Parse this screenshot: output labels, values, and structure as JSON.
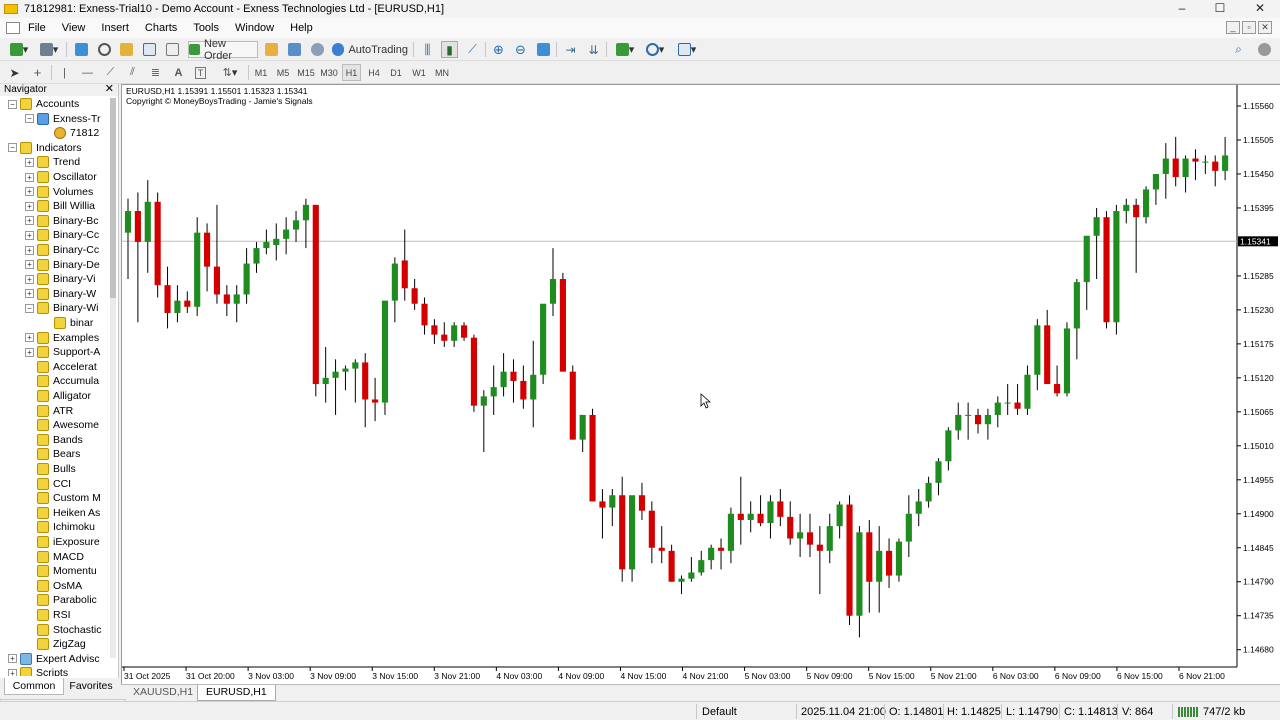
{
  "window": {
    "title": "71812981: Exness-Trial10 - Demo Account - Exness Technologies Ltd - [EURUSD,H1]",
    "controls": [
      "–",
      "☐",
      "✕"
    ]
  },
  "menu": [
    "File",
    "View",
    "Insert",
    "Charts",
    "Tools",
    "Window",
    "Help"
  ],
  "toolbar1": {
    "new_order_label": "New Order",
    "autotrading_label": "AutoTrading"
  },
  "timeframes": [
    "M1",
    "M5",
    "M15",
    "M30",
    "H1",
    "H4",
    "D1",
    "W1",
    "MN"
  ],
  "active_timeframe": "H1",
  "navigator": {
    "title": "Navigator",
    "close": "✕",
    "items": [
      {
        "label": "Accounts",
        "indent": 0,
        "expand": "−",
        "icon": "folder"
      },
      {
        "label": "Exness-Tr",
        "indent": 1,
        "expand": "−",
        "icon": "account"
      },
      {
        "label": "71812",
        "indent": 2,
        "expand": "",
        "icon": "user"
      },
      {
        "label": "Indicators",
        "indent": 0,
        "expand": "−",
        "icon": "folder"
      },
      {
        "label": "Trend",
        "indent": 1,
        "expand": "+",
        "icon": "folder"
      },
      {
        "label": "Oscillator",
        "indent": 1,
        "expand": "+",
        "icon": "folder"
      },
      {
        "label": "Volumes",
        "indent": 1,
        "expand": "+",
        "icon": "folder"
      },
      {
        "label": "Bill Willia",
        "indent": 1,
        "expand": "+",
        "icon": "folder"
      },
      {
        "label": "Binary-Bc",
        "indent": 1,
        "expand": "+",
        "icon": "folder"
      },
      {
        "label": "Binary-Cc",
        "indent": 1,
        "expand": "+",
        "icon": "folder"
      },
      {
        "label": "Binary-Cc",
        "indent": 1,
        "expand": "+",
        "icon": "folder"
      },
      {
        "label": "Binary-De",
        "indent": 1,
        "expand": "+",
        "icon": "folder"
      },
      {
        "label": "Binary-Vi",
        "indent": 1,
        "expand": "+",
        "icon": "folder"
      },
      {
        "label": "Binary-W",
        "indent": 1,
        "expand": "+",
        "icon": "folder"
      },
      {
        "label": "Binary-Wi",
        "indent": 1,
        "expand": "−",
        "icon": "folder"
      },
      {
        "label": "binar",
        "indent": 2,
        "expand": "",
        "icon": "indicator"
      },
      {
        "label": "Examples",
        "indent": 1,
        "expand": "+",
        "icon": "folder"
      },
      {
        "label": "Support-A",
        "indent": 1,
        "expand": "+",
        "icon": "folder"
      },
      {
        "label": "Accelerat",
        "indent": 1,
        "expand": "",
        "icon": "indicator"
      },
      {
        "label": "Accumula",
        "indent": 1,
        "expand": "",
        "icon": "indicator"
      },
      {
        "label": "Alligator",
        "indent": 1,
        "expand": "",
        "icon": "indicator"
      },
      {
        "label": "ATR",
        "indent": 1,
        "expand": "",
        "icon": "indicator"
      },
      {
        "label": "Awesome",
        "indent": 1,
        "expand": "",
        "icon": "indicator"
      },
      {
        "label": "Bands",
        "indent": 1,
        "expand": "",
        "icon": "indicator"
      },
      {
        "label": "Bears",
        "indent": 1,
        "expand": "",
        "icon": "indicator"
      },
      {
        "label": "Bulls",
        "indent": 1,
        "expand": "",
        "icon": "indicator"
      },
      {
        "label": "CCI",
        "indent": 1,
        "expand": "",
        "icon": "indicator"
      },
      {
        "label": "Custom M",
        "indent": 1,
        "expand": "",
        "icon": "indicator"
      },
      {
        "label": "Heiken As",
        "indent": 1,
        "expand": "",
        "icon": "indicator"
      },
      {
        "label": "Ichimoku",
        "indent": 1,
        "expand": "",
        "icon": "indicator"
      },
      {
        "label": "iExposure",
        "indent": 1,
        "expand": "",
        "icon": "indicator"
      },
      {
        "label": "MACD",
        "indent": 1,
        "expand": "",
        "icon": "indicator"
      },
      {
        "label": "Momentu",
        "indent": 1,
        "expand": "",
        "icon": "indicator"
      },
      {
        "label": "OsMA",
        "indent": 1,
        "expand": "",
        "icon": "indicator"
      },
      {
        "label": "Parabolic",
        "indent": 1,
        "expand": "",
        "icon": "indicator"
      },
      {
        "label": "RSI",
        "indent": 1,
        "expand": "",
        "icon": "indicator"
      },
      {
        "label": "Stochastic",
        "indent": 1,
        "expand": "",
        "icon": "indicator"
      },
      {
        "label": "ZigZag",
        "indent": 1,
        "expand": "",
        "icon": "indicator"
      },
      {
        "label": "Expert Advisc",
        "indent": 0,
        "expand": "+",
        "icon": "ea"
      },
      {
        "label": "Scripts",
        "indent": 0,
        "expand": "+",
        "icon": "folder"
      }
    ],
    "tabs": [
      "Common",
      "Favorites"
    ],
    "active_tab": "Common"
  },
  "chart": {
    "header": "EURUSD,H1  1.15391 1.15501 1.15323 1.15341",
    "copyright": "Copyright © MoneyBoysTrading - Jamie's Signals",
    "current_price_label": "1.15341"
  },
  "chart_data": {
    "type": "candlestick",
    "symbol": "EURUSD",
    "timeframe": "H1",
    "ylim": [
      1.14652,
      1.15594
    ],
    "y_ticks": [
      "1.15560",
      "1.15505",
      "1.15450",
      "1.15395",
      "1.15285",
      "1.15230",
      "1.15175",
      "1.15120",
      "1.15065",
      "1.15010",
      "1.14955",
      "1.14900",
      "1.14845",
      "1.14790",
      "1.14735",
      "1.14680"
    ],
    "x_labels": [
      "31 Oct 2025",
      "31 Oct 20:00",
      "3 Nov 03:00",
      "3 Nov 09:00",
      "3 Nov 15:00",
      "3 Nov 21:00",
      "4 Nov 03:00",
      "4 Nov 09:00",
      "4 Nov 15:00",
      "4 Nov 21:00",
      "5 Nov 03:00",
      "5 Nov 09:00",
      "5 Nov 15:00",
      "5 Nov 21:00",
      "6 Nov 03:00",
      "6 Nov 09:00",
      "6 Nov 15:00",
      "6 Nov 21:00"
    ],
    "current_price": 1.15341,
    "up_color": "#1e8c1e",
    "down_color": "#d40000",
    "candles": [
      [
        1.15355,
        1.1541,
        1.1528,
        1.1539
      ],
      [
        1.1539,
        1.1542,
        1.1521,
        1.1534
      ],
      [
        1.1534,
        1.1544,
        1.1529,
        1.15405
      ],
      [
        1.15405,
        1.1542,
        1.1525,
        1.1527
      ],
      [
        1.1527,
        1.153,
        1.152,
        1.15225
      ],
      [
        1.15225,
        1.1527,
        1.1521,
        1.15245
      ],
      [
        1.15245,
        1.1526,
        1.15225,
        1.15235
      ],
      [
        1.15235,
        1.1538,
        1.1522,
        1.15355
      ],
      [
        1.15355,
        1.1537,
        1.1526,
        1.153
      ],
      [
        1.153,
        1.154,
        1.1524,
        1.15255
      ],
      [
        1.15255,
        1.1527,
        1.1522,
        1.1524
      ],
      [
        1.1524,
        1.1527,
        1.1521,
        1.15255
      ],
      [
        1.15255,
        1.1533,
        1.1524,
        1.15305
      ],
      [
        1.15305,
        1.1534,
        1.1529,
        1.1533
      ],
      [
        1.1533,
        1.1536,
        1.1532,
        1.1534
      ],
      [
        1.15335,
        1.1537,
        1.1531,
        1.15345
      ],
      [
        1.15345,
        1.1538,
        1.1532,
        1.1536
      ],
      [
        1.1536,
        1.1539,
        1.1534,
        1.15375
      ],
      [
        1.15375,
        1.1541,
        1.1533,
        1.154
      ],
      [
        1.154,
        1.154,
        1.1509,
        1.1511
      ],
      [
        1.1511,
        1.1517,
        1.1508,
        1.1512
      ],
      [
        1.1512,
        1.1515,
        1.1506,
        1.1513
      ],
      [
        1.1513,
        1.1514,
        1.151,
        1.15135
      ],
      [
        1.15135,
        1.1515,
        1.1508,
        1.15145
      ],
      [
        1.15145,
        1.1516,
        1.1504,
        1.15085
      ],
      [
        1.15085,
        1.1512,
        1.1505,
        1.1508
      ],
      [
        1.1508,
        1.1514,
        1.1506,
        1.15245
      ],
      [
        1.15245,
        1.15315,
        1.1521,
        1.15305
      ],
      [
        1.1531,
        1.1536,
        1.15245,
        1.15265
      ],
      [
        1.15265,
        1.1528,
        1.1523,
        1.1524
      ],
      [
        1.1524,
        1.1525,
        1.1519,
        1.15205
      ],
      [
        1.15205,
        1.15215,
        1.15175,
        1.1519
      ],
      [
        1.1519,
        1.1521,
        1.1517,
        1.1518
      ],
      [
        1.1518,
        1.1521,
        1.1517,
        1.15205
      ],
      [
        1.15205,
        1.1521,
        1.1518,
        1.15185
      ],
      [
        1.15185,
        1.1519,
        1.15065,
        1.15075
      ],
      [
        1.15075,
        1.151,
        1.15,
        1.1509
      ],
      [
        1.1509,
        1.1514,
        1.1506,
        1.15105
      ],
      [
        1.15105,
        1.1516,
        1.1509,
        1.1513
      ],
      [
        1.1513,
        1.1515,
        1.1508,
        1.15115
      ],
      [
        1.15115,
        1.1514,
        1.1507,
        1.15085
      ],
      [
        1.15085,
        1.1518,
        1.1504,
        1.15125
      ],
      [
        1.15125,
        1.1517,
        1.1511,
        1.1524
      ],
      [
        1.1524,
        1.1533,
        1.1522,
        1.1528
      ],
      [
        1.1528,
        1.1529,
        1.1515,
        1.1513
      ],
      [
        1.1513,
        1.1514,
        1.1502,
        1.1502
      ],
      [
        1.1502,
        1.1506,
        1.15,
        1.1506
      ],
      [
        1.1506,
        1.1507,
        1.1492,
        1.1492
      ],
      [
        1.1492,
        1.1494,
        1.1486,
        1.1491
      ],
      [
        1.1491,
        1.1494,
        1.1488,
        1.1493
      ],
      [
        1.1493,
        1.1496,
        1.1479,
        1.1481
      ],
      [
        1.1481,
        1.1492,
        1.1479,
        1.1493
      ],
      [
        1.1493,
        1.1495,
        1.1489,
        1.14905
      ],
      [
        1.14905,
        1.1492,
        1.1482,
        1.14845
      ],
      [
        1.14845,
        1.1488,
        1.1482,
        1.1484
      ],
      [
        1.1484,
        1.1485,
        1.1479,
        1.1479
      ],
      [
        1.1479,
        1.148,
        1.1477,
        1.14795
      ],
      [
        1.14795,
        1.1483,
        1.1479,
        1.14805
      ],
      [
        1.14805,
        1.1484,
        1.148,
        1.14825
      ],
      [
        1.14825,
        1.1485,
        1.1481,
        1.14845
      ],
      [
        1.14845,
        1.1486,
        1.1481,
        1.1484
      ],
      [
        1.1484,
        1.1491,
        1.1482,
        1.149
      ],
      [
        1.149,
        1.1496,
        1.1485,
        1.1489
      ],
      [
        1.1489,
        1.1492,
        1.1487,
        1.149
      ],
      [
        1.149,
        1.1493,
        1.1488,
        1.14885
      ],
      [
        1.14885,
        1.1493,
        1.1486,
        1.1492
      ],
      [
        1.1492,
        1.1494,
        1.1488,
        1.14895
      ],
      [
        1.14895,
        1.1492,
        1.1485,
        1.1486
      ],
      [
        1.1486,
        1.149,
        1.1483,
        1.1487
      ],
      [
        1.1487,
        1.149,
        1.1483,
        1.1485
      ],
      [
        1.1485,
        1.1488,
        1.1477,
        1.1484
      ],
      [
        1.1484,
        1.149,
        1.1482,
        1.1488
      ],
      [
        1.1488,
        1.1492,
        1.1486,
        1.14915
      ],
      [
        1.14915,
        1.1493,
        1.1472,
        1.14735
      ],
      [
        1.14735,
        1.1488,
        1.147,
        1.1487
      ],
      [
        1.1487,
        1.1489,
        1.1474,
        1.1479
      ],
      [
        1.1479,
        1.1488,
        1.1474,
        1.1484
      ],
      [
        1.1484,
        1.1486,
        1.1478,
        1.148
      ],
      [
        1.148,
        1.1486,
        1.1479,
        1.14855
      ],
      [
        1.14855,
        1.1493,
        1.1483,
        1.149
      ],
      [
        1.149,
        1.1494,
        1.1488,
        1.1492
      ],
      [
        1.1492,
        1.1496,
        1.1491,
        1.1495
      ],
      [
        1.1495,
        1.1499,
        1.1493,
        1.14985
      ],
      [
        1.14985,
        1.1504,
        1.1497,
        1.15035
      ],
      [
        1.15035,
        1.1508,
        1.1502,
        1.1506
      ],
      [
        1.1506,
        1.1508,
        1.1502,
        1.1506
      ],
      [
        1.1506,
        1.1507,
        1.1503,
        1.15045
      ],
      [
        1.15045,
        1.1507,
        1.1502,
        1.1506
      ],
      [
        1.1506,
        1.1509,
        1.1504,
        1.1508
      ],
      [
        1.1508,
        1.1511,
        1.1506,
        1.1508
      ],
      [
        1.1508,
        1.1511,
        1.1506,
        1.1507
      ],
      [
        1.1507,
        1.1514,
        1.1506,
        1.15125
      ],
      [
        1.15125,
        1.15215,
        1.151,
        1.15205
      ],
      [
        1.15205,
        1.1523,
        1.1511,
        1.1511
      ],
      [
        1.1511,
        1.1514,
        1.1509,
        1.15095
      ],
      [
        1.15095,
        1.1521,
        1.1509,
        1.152
      ],
      [
        1.152,
        1.1528,
        1.1515,
        1.15275
      ],
      [
        1.15275,
        1.1532,
        1.1523,
        1.1535
      ],
      [
        1.1535,
        1.15395,
        1.1528,
        1.1538
      ],
      [
        1.1538,
        1.1539,
        1.152,
        1.1521
      ],
      [
        1.1521,
        1.154,
        1.1519,
        1.1539
      ],
      [
        1.1539,
        1.1541,
        1.1537,
        1.154
      ],
      [
        1.154,
        1.1541,
        1.1529,
        1.1538
      ],
      [
        1.1538,
        1.1543,
        1.1537,
        1.15425
      ],
      [
        1.15425,
        1.1545,
        1.154,
        1.1545
      ],
      [
        1.1545,
        1.155,
        1.1541,
        1.15475
      ],
      [
        1.15475,
        1.1551,
        1.1543,
        1.15445
      ],
      [
        1.15445,
        1.1548,
        1.1542,
        1.15475
      ],
      [
        1.15475,
        1.1549,
        1.1544,
        1.1547
      ],
      [
        1.1547,
        1.1548,
        1.1545,
        1.1547
      ],
      [
        1.1547,
        1.1548,
        1.1543,
        1.15455
      ],
      [
        1.15455,
        1.1551,
        1.1544,
        1.1548
      ]
    ]
  },
  "chart_tabs": [
    "XAUUSD,H1",
    "EURUSD,H1"
  ],
  "active_chart_tab": "EURUSD,H1",
  "statusbar": {
    "profile": "Default",
    "datetime": "2025.11.04 21:00",
    "open": "O: 1.14801",
    "high": "H: 1.14825",
    "low": "L: 1.14790",
    "close": "C: 1.14813",
    "volume": "V: 864",
    "traffic": "747/2 kb"
  },
  "mdi_minimized": {
    "left": "⧉",
    "right": "✕"
  }
}
